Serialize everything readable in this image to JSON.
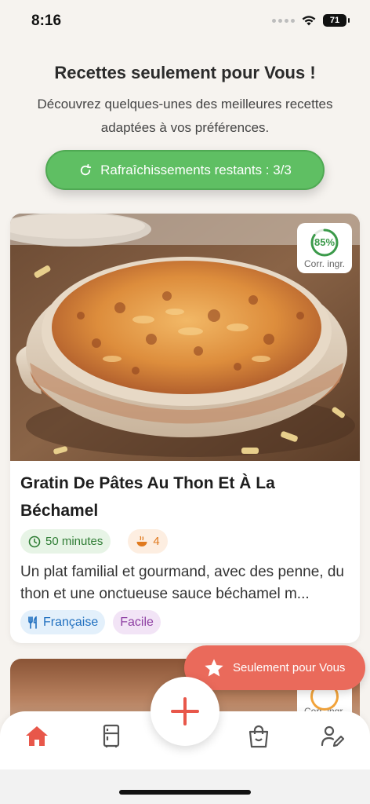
{
  "status_bar": {
    "time": "8:16",
    "battery": "71"
  },
  "header": {
    "title": "Recettes seulement pour Vous !",
    "subtitle": "Découvrez quelques-unes des meilleures recettes adaptées à vos préférences."
  },
  "refresh_button": {
    "label": "Rafraîchissements restants : 3/3",
    "icon": "refresh-icon"
  },
  "recipes": [
    {
      "match_percent": "85%",
      "match_value": 0.85,
      "match_label": "Corr. ingr.",
      "title": "Gratin De Pâtes Au Thon Et À La Béchamel",
      "duration": "50 minutes",
      "servings": "4",
      "description": "Un plat familial et gourmand, avec des penne, du thon et une onctueuse sauce béchamel m...",
      "cuisine": "Française",
      "difficulty": "Facile"
    },
    {
      "match_label": "Corr. ingr."
    }
  ],
  "floating_button": {
    "label": "Seulement pour Vous",
    "icon": "star-icon"
  },
  "nav": {
    "items": [
      "home-icon",
      "fridge-icon",
      "add-icon",
      "shopping-bag-icon",
      "profile-edit-icon"
    ],
    "active": "home-icon"
  },
  "colors": {
    "accent_green": "#5fbf63",
    "accent_coral": "#ea6a5b",
    "background": "#f6f3ef"
  }
}
